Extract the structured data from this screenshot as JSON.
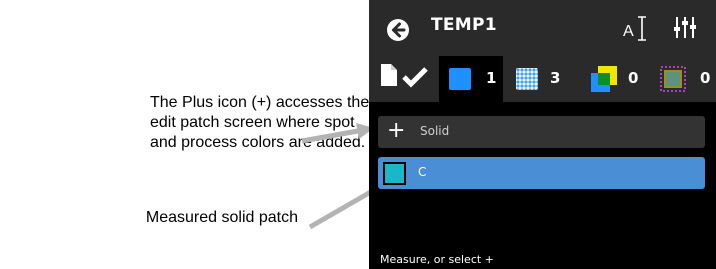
{
  "annotations": {
    "plus_line1": "The Plus icon (+) accesses the",
    "plus_line2": "edit patch screen where spot",
    "plus_line3": "and process colors are added.",
    "measured": "Measured solid patch"
  },
  "header": {
    "title": "TEMP1",
    "back_icon": "back-arrow-icon",
    "font_icon": "text-size-icon",
    "settings_icon": "sliders-icon"
  },
  "tabs": [
    {
      "icon": "document-icon"
    },
    {
      "icon": "check-icon"
    },
    {
      "icon": "solid-patch-icon",
      "count": "1",
      "color": "#1e90ff"
    },
    {
      "icon": "halftone-patch-icon",
      "count": "3",
      "color": "#3aa0ff"
    },
    {
      "icon": "overprint-patch-icon",
      "count": "0",
      "colors": [
        "#f2e600",
        "#0a8f2b",
        "#1e90ff"
      ]
    },
    {
      "icon": "paper-patch-icon",
      "count": "0"
    }
  ],
  "list": {
    "add_symbol": "+",
    "add_label": "Solid",
    "items": [
      {
        "label": "C",
        "swatch": "#1ab7c8"
      }
    ]
  },
  "status": "Measure, or select +",
  "colors": {
    "selection": "#4a8fd6",
    "header_bg": "#2a2a2a",
    "cyan_swatch": "#1ab7c8"
  }
}
